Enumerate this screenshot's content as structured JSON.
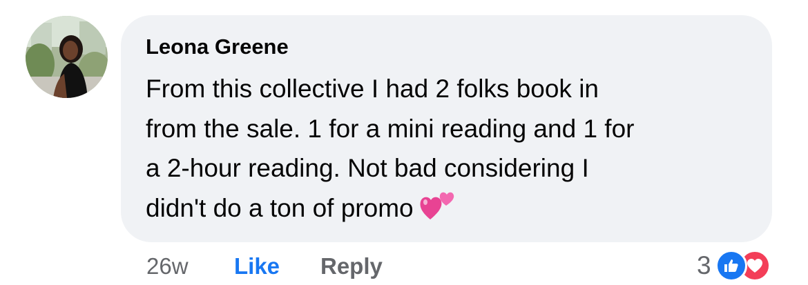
{
  "comment": {
    "author": "Leona Greene",
    "lines": [
      "From this collective I had 2 folks book in",
      "from the sale. 1 for a mini reading and 1 for",
      "a 2-hour reading. Not bad considering I",
      "didn't do a ton of promo"
    ],
    "emoji": "two-hearts-icon",
    "timestamp": "26w",
    "like_label": "Like",
    "reply_label": "Reply",
    "reaction_count": "3",
    "reaction_icons": [
      "like-reaction-icon",
      "love-reaction-icon"
    ]
  },
  "colors": {
    "bubble": "#f0f2f5",
    "text": "#050505",
    "secondary": "#65676b",
    "like_blue": "#1877f2",
    "love_red": "#f33e58",
    "heart_pink": "#e84393"
  }
}
